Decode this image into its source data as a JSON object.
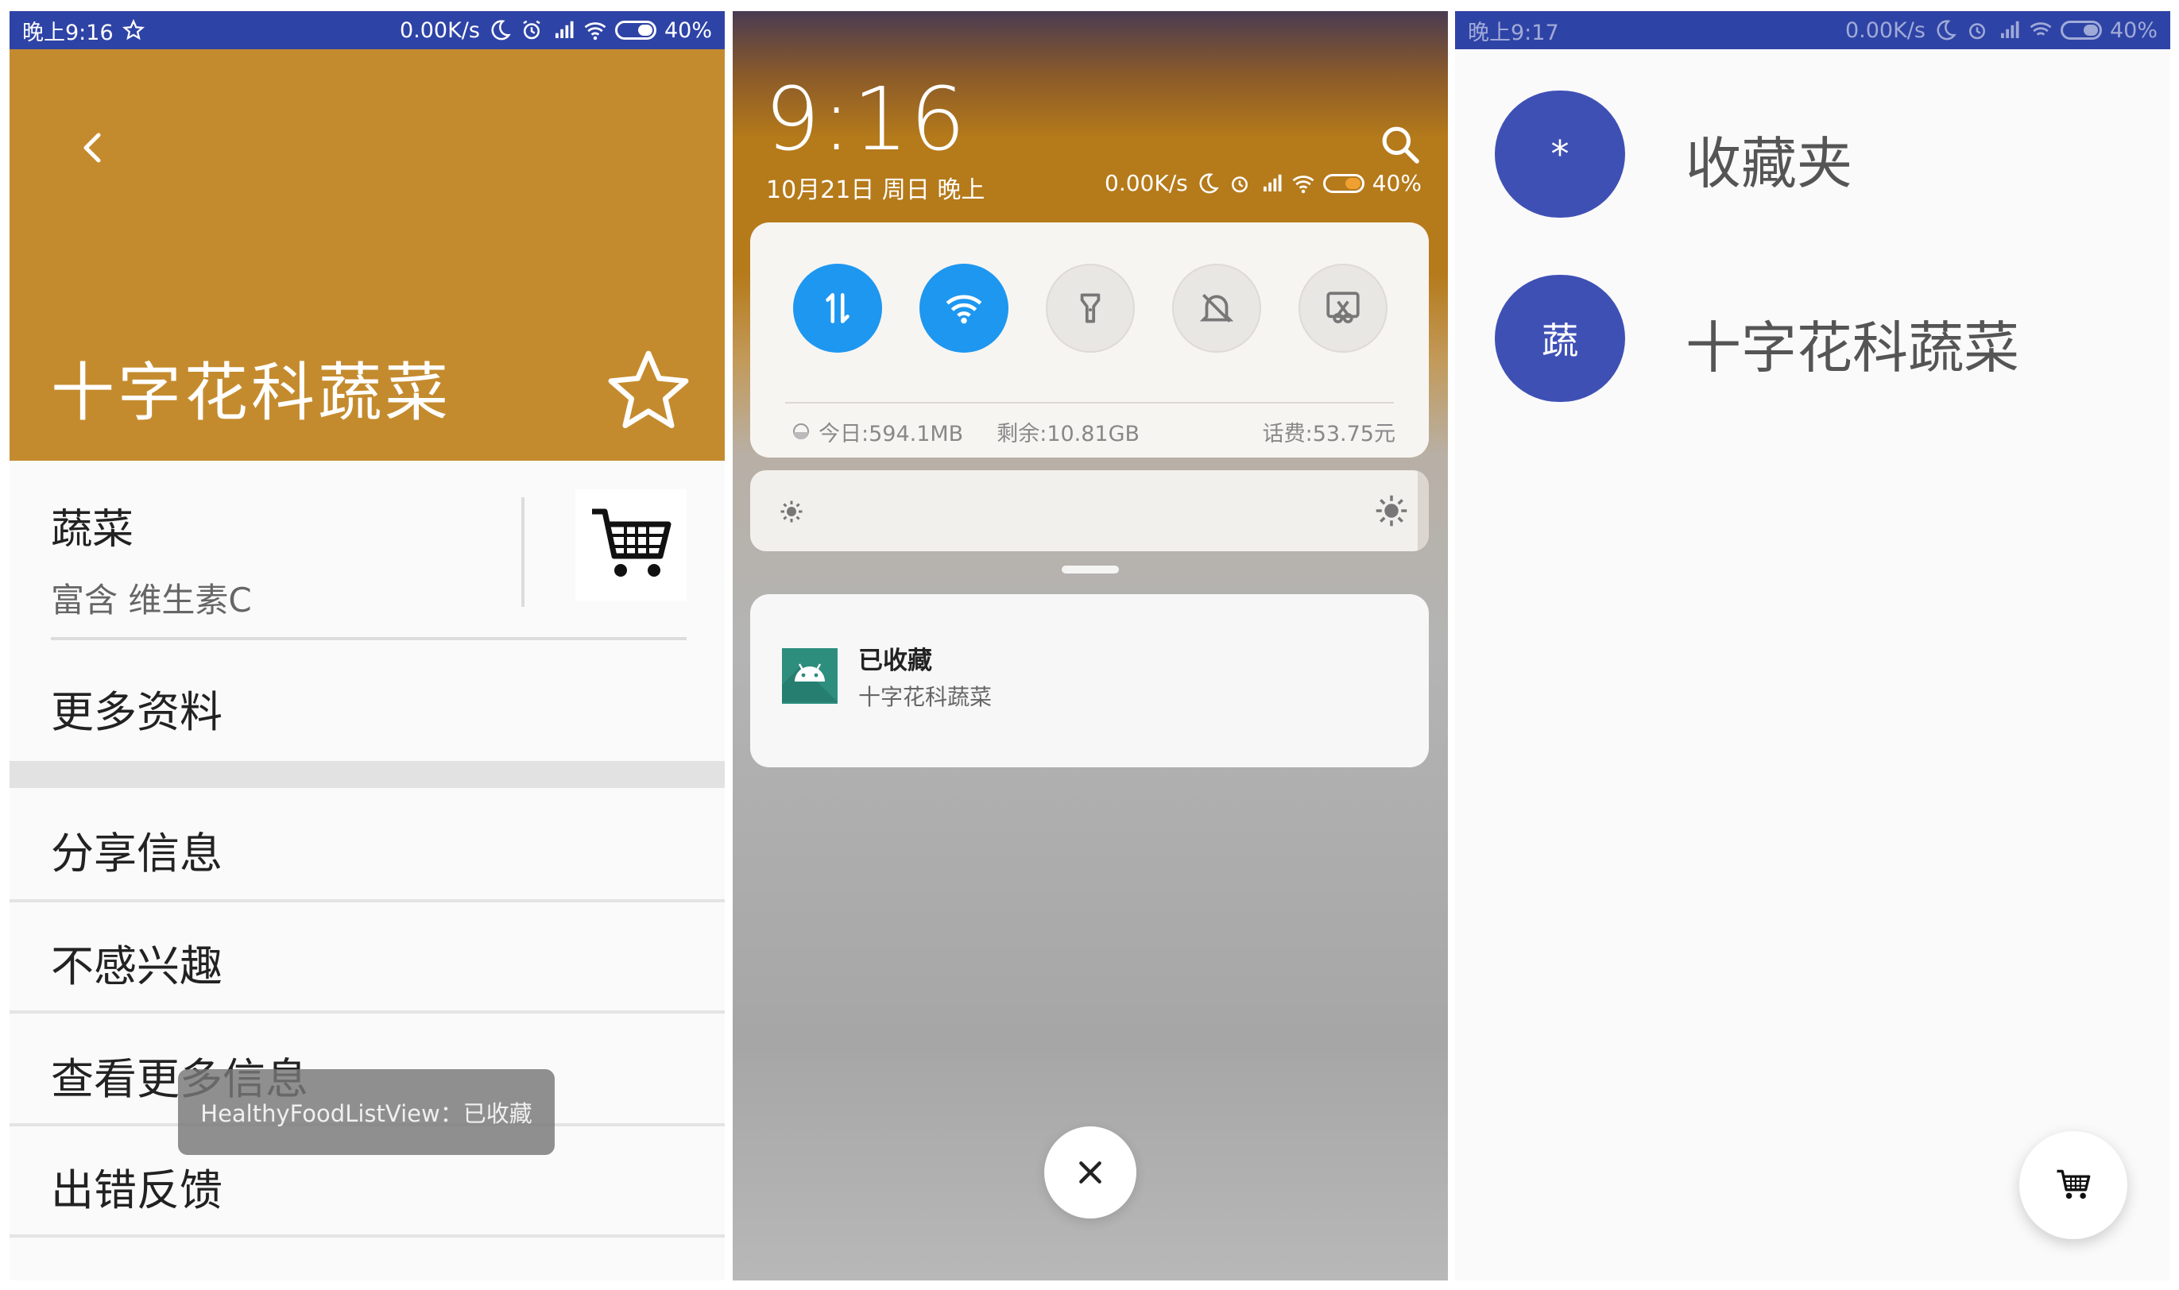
{
  "panel1": {
    "statusbar": {
      "time": "晚上9:16",
      "net": "0.00K/s",
      "battery": "40%",
      "battery_level": 0.4
    },
    "header": {
      "title": "十字花科蔬菜",
      "back_icon": "chevron-left-icon",
      "star_icon": "star-outline-icon"
    },
    "category": {
      "title": "蔬菜",
      "subtitle": "富含 维生素C",
      "cart_icon": "shopping-cart-icon"
    },
    "menu": [
      "更多资料",
      "分享信息",
      "不感兴趣",
      "查看更多信息",
      "出错反馈"
    ],
    "toast": "HealthyFoodListView：已收藏",
    "colors": {
      "header": "#c48b2e",
      "statusbar": "#2e43a6"
    }
  },
  "panel2": {
    "time": "9:16",
    "date": "10月21日 周日 晚上",
    "net": "0.00K/s",
    "battery": "40%",
    "battery_level": 0.4,
    "toggles": [
      {
        "name": "mobile-data-toggle",
        "icon": "data-arrows-icon",
        "on": true
      },
      {
        "name": "wifi-toggle",
        "icon": "wifi-icon",
        "on": true
      },
      {
        "name": "flashlight-toggle",
        "icon": "flashlight-icon",
        "on": false
      },
      {
        "name": "mute-toggle",
        "icon": "bell-off-icon",
        "on": false
      },
      {
        "name": "screenshot-toggle",
        "icon": "scissors-icon",
        "on": false
      }
    ],
    "stats": {
      "today": "今日:594.1MB",
      "remaining": "剩余:10.81GB",
      "fee": "话费:53.75元"
    },
    "notification": {
      "title": "已收藏",
      "text": "十字花科蔬菜",
      "icon": "android-app-icon"
    },
    "colors": {
      "toggle_on": "#1e97f0"
    }
  },
  "panel3": {
    "statusbar": {
      "time": "晚上9:17",
      "net": "0.00K/s",
      "battery": "40%",
      "battery_level": 0.4
    },
    "items": [
      {
        "avatar": "*",
        "label": "收藏夹"
      },
      {
        "avatar": "蔬",
        "label": "十字花科蔬菜"
      }
    ],
    "fab_icon": "shopping-cart-icon",
    "colors": {
      "avatar": "#3f50b5"
    }
  }
}
